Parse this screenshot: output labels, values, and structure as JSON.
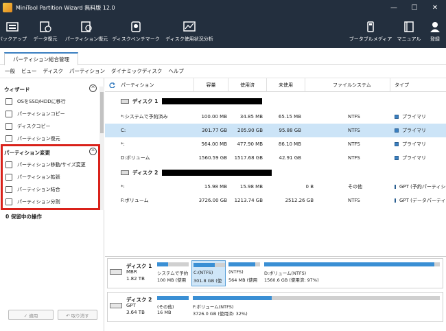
{
  "window": {
    "title": "MiniTool Partition Wizard 無料版 12.0",
    "minimize": "—",
    "maximize": "☐",
    "close": "✕"
  },
  "toolbar": {
    "left": [
      {
        "label": "バックアップ",
        "icon": "backup-icon"
      },
      {
        "label": "データ復元",
        "icon": "data-recovery-icon"
      },
      {
        "label": "パーティション復元",
        "icon": "partition-recovery-icon"
      },
      {
        "label": "ディスクベンチマーク",
        "icon": "disk-benchmark-icon"
      },
      {
        "label": "ディスク使用状況分析",
        "icon": "space-analyzer-icon"
      }
    ],
    "right": [
      {
        "label": "ブータブルメディア",
        "icon": "bootable-media-icon"
      },
      {
        "label": "マニュアル",
        "icon": "manual-icon"
      },
      {
        "label": "登録",
        "icon": "register-icon"
      }
    ]
  },
  "tab": {
    "label": "パーティション総合管理"
  },
  "menu": [
    "一般",
    "ビュー",
    "ディスク",
    "パーティション",
    "ダイナミックディスク",
    "ヘルプ"
  ],
  "sidebar": {
    "wizard_title": "ウィザード",
    "wizard_items": [
      "OSをSSD/HDDに移行",
      "パーティションコピー",
      "ディスクコピー",
      "パーティション復元"
    ],
    "change_title": "パーティション変更",
    "change_items": [
      "パーティション移動/サイズ変更",
      "パーティション拡張",
      "パーティション結合",
      "パーティション分割"
    ],
    "pending": "0 保留中の操作",
    "apply": "✓ 適用",
    "undo": "↶ 取り消す",
    "collapse_glyph": "^"
  },
  "table": {
    "headers": [
      "パーティション",
      "容量",
      "使用済",
      "未使用",
      "ファイルシステム",
      "タイプ"
    ],
    "disk1": {
      "label": "ディスク 1",
      "rows": [
        {
          "name": "*:システムで予約済み",
          "capacity": "100.00 MB",
          "used": "34.85 MB",
          "unused": "65.15 MB",
          "fs": "NTFS",
          "type": "プライマリ"
        },
        {
          "name": "C:",
          "capacity": "301.77 GB",
          "used": "205.90 GB",
          "unused": "95.88 GB",
          "fs": "NTFS",
          "type": "プライマリ"
        },
        {
          "name": "*:",
          "capacity": "564.00 MB",
          "used": "477.90 MB",
          "unused": "86.10 MB",
          "fs": "NTFS",
          "type": "プライマリ"
        },
        {
          "name": "D:ボリューム",
          "capacity": "1560.59 GB",
          "used": "1517.68 GB",
          "unused": "42.91 GB",
          "fs": "NTFS",
          "type": "プライマリ"
        }
      ]
    },
    "disk2": {
      "label": "ディスク 2",
      "rows": [
        {
          "name": "*:",
          "capacity": "15.98 MB",
          "used": "15.98 MB",
          "unused": "0 B",
          "fs": "その他",
          "type": "GPT (予約パーティション)"
        },
        {
          "name": "F:ボリューム",
          "capacity": "3726.00 GB",
          "used": "1213.74 GB",
          "unused": "2512.26 GB",
          "fs": "NTFS",
          "type": "GPT (データパーティション)"
        }
      ]
    }
  },
  "diskmap": {
    "disk1": {
      "name": "ディスク 1",
      "style": "MBR",
      "size": "1.82 TB",
      "parts": [
        {
          "l1": "システムで予約",
          "l2": "100 MB (使用",
          "used_fraction": 0.35
        },
        {
          "l1": "C:(NTFS)",
          "l2": "301.8 GB (使",
          "used_fraction": 0.68
        },
        {
          "l1": "(NTFS)",
          "l2": "564 MB (使用",
          "used_fraction": 0.85
        },
        {
          "l1": "D:ボリューム(NTFS)",
          "l2": "1560.6 GB (使用済: 97%)",
          "used_fraction": 0.97
        }
      ]
    },
    "disk2": {
      "name": "ディスク 2",
      "style": "GPT",
      "size": "3.64 TB",
      "parts": [
        {
          "l1": "(その他)",
          "l2": "16 MB",
          "used_fraction": 1.0
        },
        {
          "l1": "F:ボリューム(NTFS)",
          "l2": "3726.0 GB (使用済: 32%)",
          "used_fraction": 0.32
        }
      ]
    }
  },
  "colors": {
    "accent": "#3a8fd4",
    "toolbar": "#232f3e",
    "selected_row": "#cce4f7",
    "highlight_box": "#d9211a"
  }
}
